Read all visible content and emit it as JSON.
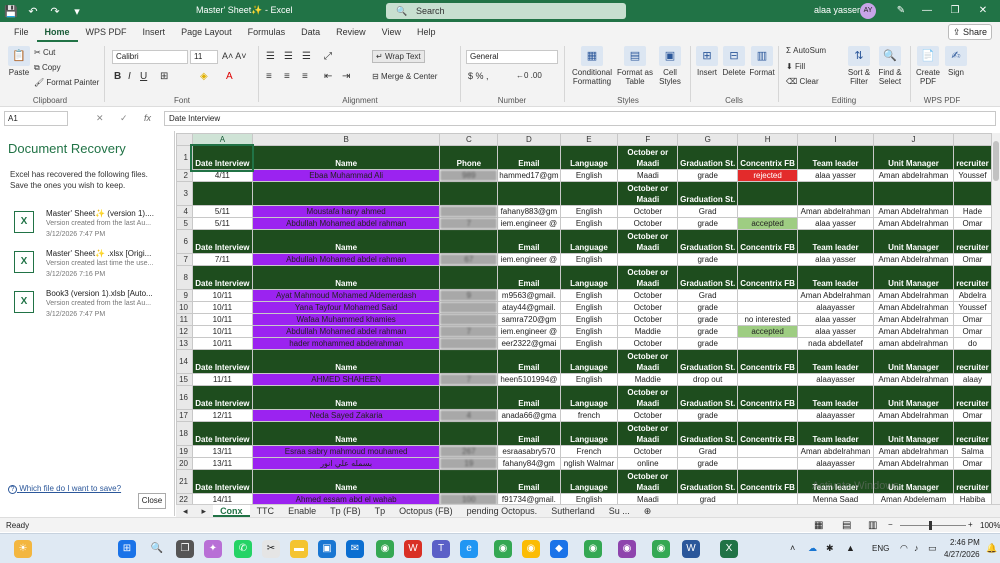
{
  "titlebar": {
    "doc_title": "Master' Sheet✨ - Excel",
    "search_placeholder": "Search",
    "user_name": "alaa yasser",
    "user_initials": "AY"
  },
  "menu": {
    "tabs": [
      "File",
      "Home",
      "WPS PDF",
      "Insert",
      "Page Layout",
      "Formulas",
      "Data",
      "Review",
      "View",
      "Help"
    ],
    "active": "Home",
    "share": "Share"
  },
  "ribbon": {
    "clipboard": {
      "paste": "Paste",
      "cut": "Cut",
      "copy": "Copy",
      "format_painter": "Format Painter",
      "label": "Clipboard"
    },
    "font": {
      "name": "Calibri",
      "size": "11",
      "label": "Font"
    },
    "alignment": {
      "wrap": "Wrap Text",
      "merge": "Merge & Center",
      "label": "Alignment"
    },
    "number": {
      "format": "General",
      "label": "Number"
    },
    "styles": {
      "cond": "Conditional Formatting",
      "table": "Format as Table",
      "cell": "Cell Styles",
      "label": "Styles"
    },
    "cells": {
      "insert": "Insert",
      "delete": "Delete",
      "format": "Format",
      "label": "Cells"
    },
    "editing": {
      "autosum": "AutoSum",
      "fill": "Fill",
      "clear": "Clear",
      "sort": "Sort & Filter",
      "find": "Find & Select",
      "label": "Editing"
    },
    "wps": {
      "create": "Create PDF",
      "sign": "Sign",
      "label": "WPS PDF"
    }
  },
  "formula": {
    "name_box": "A1",
    "fx": "fx",
    "content": "Date Interview"
  },
  "recovery": {
    "title": "Document Recovery",
    "desc": "Excel has recovered the following files. Save the ones you wish to keep.",
    "files": [
      {
        "name": "Master' Sheet✨ (version 1)....",
        "sub1": "Version created from the last Au...",
        "sub2": "3/12/2026 7:47 PM"
      },
      {
        "name": "Master' Sheet✨ .xlsx  [Origi...",
        "sub1": "Version created last time the use...",
        "sub2": "3/12/2026 7:16 PM"
      },
      {
        "name": "Book3 (version 1).xlsb  [Auto...",
        "sub1": "Version created from the last Au...",
        "sub2": "3/12/2026 7:47 PM"
      }
    ],
    "help": "Which file do I want to save?",
    "close": "Close"
  },
  "grid": {
    "columns": [
      "A",
      "B",
      "C",
      "D",
      "E",
      "F",
      "G",
      "H",
      "I",
      "J",
      ""
    ],
    "rows": [
      {
        "n": "1",
        "hdr": true,
        "c": [
          "Date Interview",
          "Name",
          "Phone",
          "Email",
          "Language",
          "October or Maadi",
          "Graduation St.",
          "Concentrix FB",
          "Team leader",
          "Unit Manager",
          "recruiter"
        ]
      },
      {
        "n": "2",
        "c": [
          "4/11",
          "Ebaa Muhammad Ali",
          "989",
          "hammed17@gm",
          "English",
          "Maadi",
          "grade",
          "rejected",
          "alaa yasser",
          "Aman abdelrahman",
          "Youssef"
        ]
      },
      {
        "n": "3",
        "hdr": true,
        "c": [
          "",
          "",
          "",
          "",
          "",
          "October or Maadi",
          "Graduation St.",
          "",
          "",
          "",
          ""
        ]
      },
      {
        "n": "4",
        "c": [
          "5/11",
          "Moustafa hany ahmed",
          "",
          "fahany883@gm",
          "English",
          "October",
          "Grad",
          "",
          "Aman abdelrahman",
          "Aman Abdelrahman",
          "Hade"
        ]
      },
      {
        "n": "5",
        "c": [
          "5/11",
          "Abdullah Mohamed abdel rahman",
          "7",
          "iem.engineer @",
          "English",
          "October",
          "grade",
          "accepted",
          "alaa yasser",
          "Aman Abdelrahman",
          "Omar"
        ]
      },
      {
        "n": "6",
        "hdr": true,
        "c": [
          "Date Interview",
          "Name",
          "",
          "Email",
          "Language",
          "October or Maadi",
          "Graduation St.",
          "Concentrix FB",
          "Team leader",
          "Unit Manager",
          "recruiter"
        ]
      },
      {
        "n": "7",
        "c": [
          "7/11",
          "Abdullah Mohamed abdel rahman",
          "67",
          "iem.engineer @",
          "English",
          "",
          "grade",
          "",
          "alaa yasser",
          "Aman Abdelrahman",
          "Omar"
        ]
      },
      {
        "n": "8",
        "hdr": true,
        "c": [
          "Date Interview",
          "Name",
          "",
          "Email",
          "Language",
          "October or Maadi",
          "Graduation St.",
          "Concentrix FB",
          "Team leader",
          "Unit Manager",
          "recruiter"
        ]
      },
      {
        "n": "9",
        "c": [
          "10/11",
          "Ayat Mahmoud Mohamed Aldemerdash",
          "9",
          "m9563@gmail.",
          "English",
          "October",
          "Grad",
          "",
          "Aman Abdelrahman",
          "Aman Abdelrahman",
          "Abdelra"
        ]
      },
      {
        "n": "10",
        "c": [
          "10/11",
          "Yana Tayfour Mohamed Said",
          "",
          "atay44@gmail.",
          "English",
          "October",
          "grade",
          "",
          "alaayasser",
          "Aman Abdelrahman",
          "Youssef"
        ]
      },
      {
        "n": "11",
        "c": [
          "10/11",
          "Wafaa Muhammed khamies",
          "",
          "samra720@gm",
          "English",
          "October",
          "grade",
          "no interested",
          "alaa yasser",
          "Aman Abdelrahman",
          "Omar"
        ]
      },
      {
        "n": "12",
        "c": [
          "10/11",
          "Abdullah Mohamed abdel rahman",
          "7",
          "iem.engineer @",
          "English",
          "Maddie",
          "grade",
          "accepted",
          "alaa yasser",
          "Aman Abdelrahman",
          "Omar"
        ]
      },
      {
        "n": "13",
        "c": [
          "10/11",
          "hader mohammed abdelrahman",
          "",
          "eer2322@gmai",
          "English",
          "October",
          "grade",
          "",
          "nada abdellatef",
          "aman abdelrahman",
          "do"
        ]
      },
      {
        "n": "14",
        "hdr": true,
        "c": [
          "Date Interview",
          "Name",
          "",
          "Email",
          "Language",
          "October or Maadi",
          "Graduation St.",
          "Concentrix FB",
          "Team leader",
          "Unit Manager",
          "recruiter"
        ]
      },
      {
        "n": "15",
        "c": [
          "11/11",
          "AHMED SHAHEEN",
          "7",
          "heen5101994@",
          "English",
          "Maddie",
          "drop out",
          "",
          "alaayasser",
          "Aman Abdelrahman",
          "alaay"
        ]
      },
      {
        "n": "16",
        "hdr": true,
        "c": [
          "Date Interview",
          "Name",
          "",
          "Email",
          "Language",
          "October or Maadi",
          "Graduation St.",
          "Concentrix FB",
          "Team leader",
          "Unit Manager",
          "recruiter"
        ]
      },
      {
        "n": "17",
        "c": [
          "12/11",
          "Neda Sayed Zakaria",
          "4",
          "anada66@gma",
          "french",
          "October",
          "grade",
          "",
          "alaayasser",
          "Aman Abdelrahman",
          "Omar"
        ]
      },
      {
        "n": "18",
        "hdr": true,
        "c": [
          "Date Interview",
          "Name",
          "",
          "Email",
          "Language",
          "October or Maadi",
          "Graduation St.",
          "Concentrix FB",
          "Team leader",
          "Unit Manager",
          "recruiter"
        ]
      },
      {
        "n": "19",
        "c": [
          "13/11",
          "Esraa sabry mahmoud mouhamed",
          "267",
          "esraasabry570",
          "French",
          "October",
          "Grad",
          "",
          "Aman abdelrahman",
          "Aman abdelrahman",
          "Salma"
        ]
      },
      {
        "n": "20",
        "c": [
          "13/11",
          "بسمله علي انور",
          "19",
          "fahany84@gm",
          "nglish Walmar",
          "online",
          "grade",
          "",
          "alaayasser",
          "Aman Abdelrahman",
          "Omar"
        ]
      },
      {
        "n": "21",
        "hdr": true,
        "c": [
          "Date Interview",
          "Name",
          "",
          "Email",
          "Language",
          "October or Maadi",
          "Graduation St.",
          "Concentrix FB",
          "Team leader",
          "Unit Manager",
          "recruiter"
        ]
      },
      {
        "n": "22",
        "c": [
          "14/11",
          "Ahmed essam abd el wahab",
          "100",
          "f91734@gmail.",
          "English",
          "Maadi",
          "grad",
          "",
          "Menna Saad",
          "Aman Abdelemam",
          "Habiba"
        ]
      }
    ]
  },
  "sheets": {
    "tabs": [
      "Conx",
      "TTC",
      "Enable",
      "Tp (FB)",
      "Tp",
      "Octopus (FB)",
      "pending Octopus.",
      "Sutherland",
      "Su ..."
    ],
    "active": "Conx"
  },
  "status": {
    "left": "Ready",
    "zoom": "100%"
  },
  "tray": {
    "lang": "ENG",
    "time": "2:46 PM",
    "date": "4/27/2026"
  },
  "watermark": "Activate Windows",
  "colors": {
    "excel_green": "#217346",
    "header_fill": "#1e4d1e",
    "name_fill": "#9b23f0",
    "rejected_fill": "#e32b2b",
    "accepted_fill": "#9ecd82"
  }
}
